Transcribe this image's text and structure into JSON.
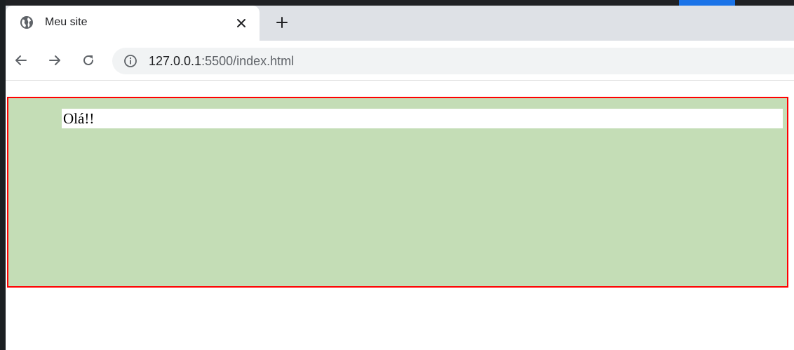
{
  "tab": {
    "title": "Meu site",
    "icon": "globe-icon"
  },
  "toolbar": {
    "back_icon": "back-arrow-icon",
    "forward_icon": "forward-arrow-icon",
    "reload_icon": "reload-icon",
    "info_icon": "info-icon"
  },
  "address": {
    "host": "127.0.0.1",
    "rest": ":5500/index.html"
  },
  "page": {
    "greeting": "Olá!!"
  },
  "colors": {
    "container_background": "#c4ddb6",
    "container_border": "#ff0000",
    "tabbar_background": "#dee1e6",
    "window_frame": "#202124",
    "accent": "#1a73e8"
  }
}
